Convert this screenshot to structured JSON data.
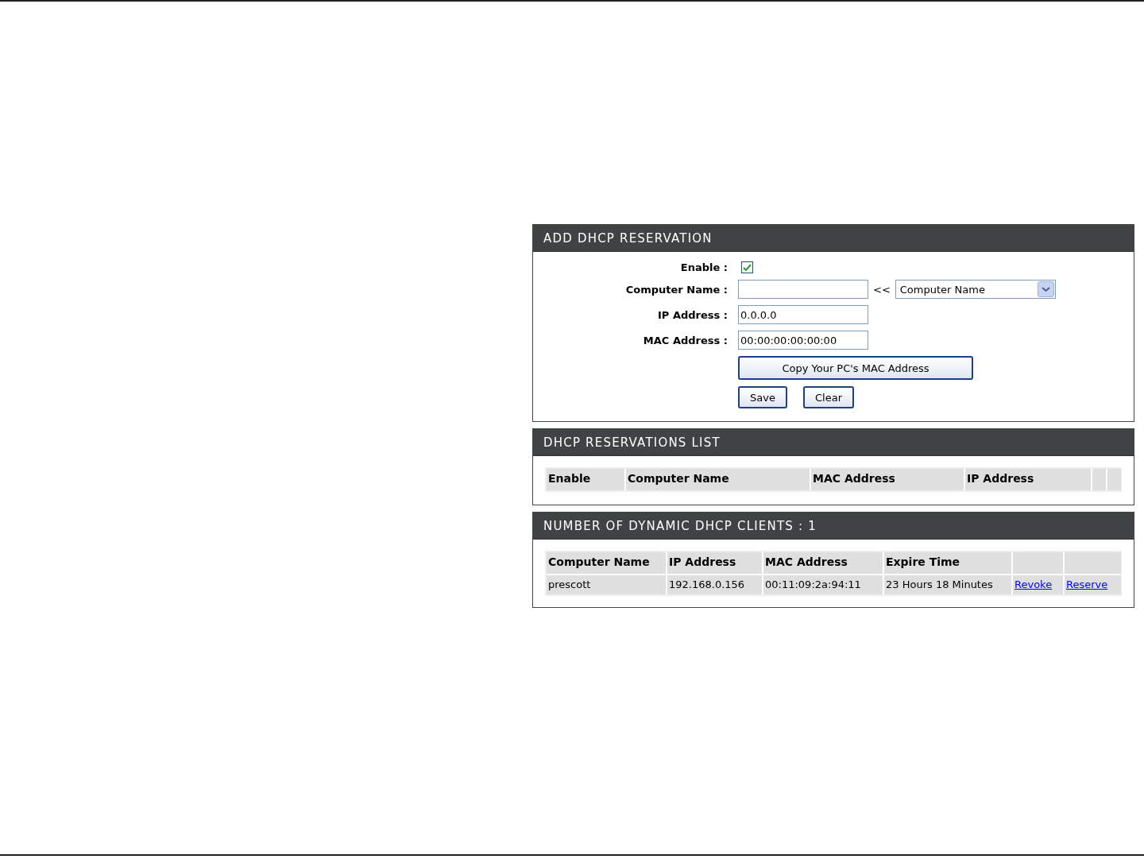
{
  "add_reservation": {
    "title": "ADD DHCP RESERVATION",
    "enable": {
      "label": "Enable :",
      "checked": true
    },
    "computer_name": {
      "label": "Computer Name :",
      "arrow": "<<",
      "select": "Computer Name"
    },
    "ip_address": {
      "label": "IP Address :",
      "value": "0.0.0.0"
    },
    "mac_address": {
      "label": "MAC Address :",
      "value": "00:00:00:00:00:00"
    },
    "copy_button": "Copy Your PC's MAC Address",
    "buttons": [
      "Save",
      "Clear"
    ]
  },
  "reservations_list": {
    "title": "DHCP RESERVATIONS LIST",
    "columns": [
      "Enable",
      "Computer Name",
      "MAC Address",
      "IP Address"
    ]
  },
  "dynamic_clients": {
    "title": "NUMBER OF DYNAMIC DHCP CLIENTS : 1",
    "columns": [
      "Computer Name",
      "IP Address",
      "MAC Address",
      "Expire Time"
    ],
    "rows": [
      {
        "computer_name": "prescott",
        "ip_address": "192.168.0.156",
        "mac_address": "00:11:09:2a:94:11",
        "expire_time": "23 Hours 18 Minutes",
        "actions": [
          "Revoke",
          "Reserve"
        ]
      }
    ]
  }
}
